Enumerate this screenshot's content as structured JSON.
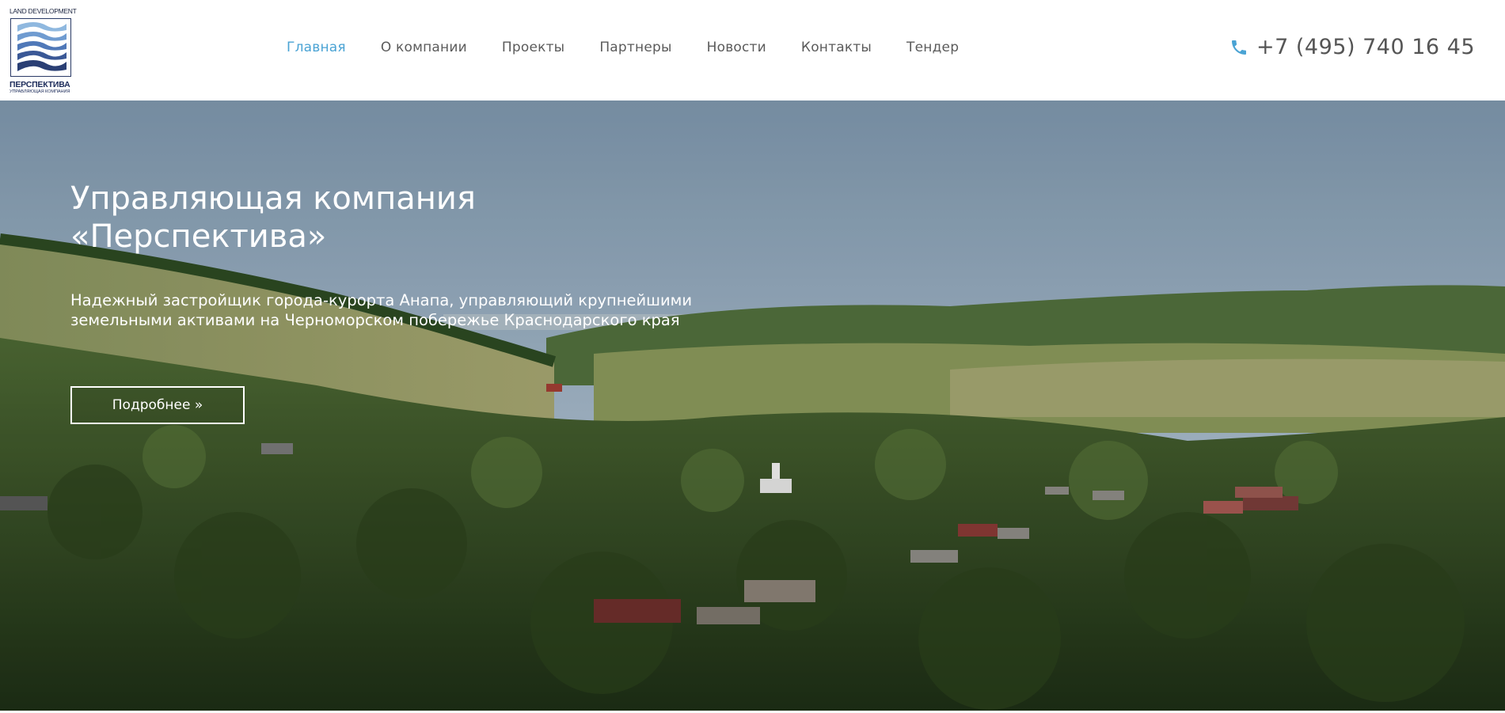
{
  "logo": {
    "top_text": "LAND DEVELOPMENT",
    "name": "ПЕРСПЕКТИВА",
    "subtitle": "УПРАВЛЯЮЩАЯ КОМПАНИЯ",
    "icon": "waves-logo-icon"
  },
  "nav": {
    "items": [
      {
        "label": "Главная",
        "active": true
      },
      {
        "label": "О компании",
        "active": false
      },
      {
        "label": "Проекты",
        "active": false
      },
      {
        "label": "Партнеры",
        "active": false
      },
      {
        "label": "Новости",
        "active": false
      },
      {
        "label": "Контакты",
        "active": false
      },
      {
        "label": "Тендер",
        "active": false
      }
    ]
  },
  "phone": {
    "icon": "phone-icon",
    "number": "+7 (495) 740 16 45"
  },
  "hero": {
    "title_line1": "Управляющая компания",
    "title_line2": "«Перспектива»",
    "desc_line1": "Надежный застройщик города-курорта Анапа, управляющий крупнейшими",
    "desc_line2": "земельными активами на Черноморском побережье Краснодарского края",
    "button_label": "Подробнее »"
  },
  "colors": {
    "accent": "#4aa3d4",
    "nav_text": "#5b5b5b",
    "logo_dark": "#1c2b5a"
  }
}
